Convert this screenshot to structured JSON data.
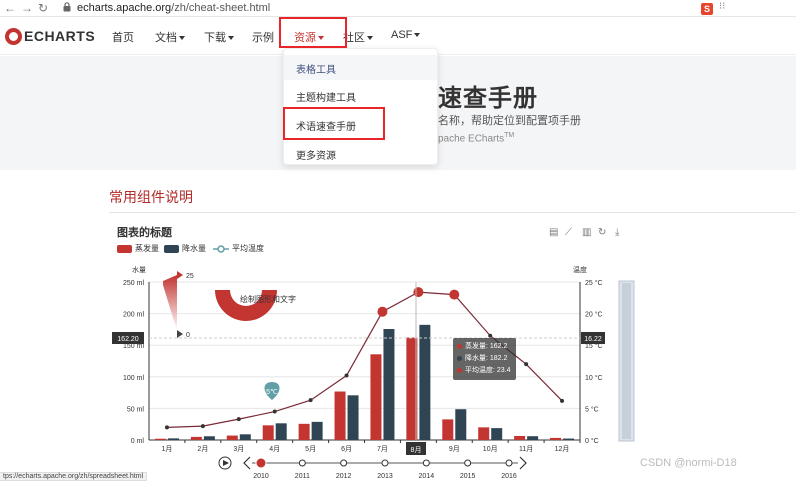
{
  "browser": {
    "url_host": "echarts.apache.org",
    "url_path": "/zh/cheat-sheet.html",
    "ext_label": "S"
  },
  "navbar": {
    "logo_text": "ECHARTS",
    "items": [
      {
        "label": "首页"
      },
      {
        "label": "文档"
      },
      {
        "label": "下载"
      },
      {
        "label": "示例"
      },
      {
        "label": "资源"
      },
      {
        "label": "社区"
      },
      {
        "label": "ASF"
      }
    ]
  },
  "dropdown": {
    "items": [
      {
        "label": "表格工具"
      },
      {
        "label": "主题构建工具"
      },
      {
        "label": "术语速查手册"
      },
      {
        "label": "更多资源"
      }
    ]
  },
  "hero": {
    "title": "速查手册",
    "subtitle": "名称，帮助定位到配置项手册",
    "sub2": "pache ECharts",
    "sub2_sup": "TM"
  },
  "section": {
    "title": "常用组件说明"
  },
  "chart_data": {
    "type": "bar",
    "title": "图表的标题",
    "categories": [
      "1月",
      "2月",
      "3月",
      "4月",
      "5月",
      "6月",
      "7月",
      "8月",
      "9月",
      "10月",
      "11月",
      "12月"
    ],
    "series": [
      {
        "name": "蒸发量",
        "type": "bar",
        "color": "#c23531",
        "values": [
          2.0,
          4.9,
          7.0,
          23.2,
          25.6,
          76.7,
          135.6,
          162.2,
          32.6,
          20.0,
          6.4,
          3.3
        ]
      },
      {
        "name": "降水量",
        "type": "bar",
        "color": "#2f4554",
        "values": [
          2.6,
          5.9,
          9.0,
          26.4,
          28.7,
          70.7,
          175.6,
          182.2,
          48.7,
          18.8,
          6.0,
          2.3
        ]
      },
      {
        "name": "平均温度",
        "type": "line",
        "color": "#61a0a8",
        "values": [
          2.0,
          2.2,
          3.3,
          4.5,
          6.3,
          10.2,
          20.3,
          23.4,
          23.0,
          16.5,
          12.0,
          6.2
        ]
      }
    ],
    "ylabel_left": "水量",
    "ylabel_right": "温度",
    "y_left_ticks": [
      "0 ml",
      "50 ml",
      "100 ml",
      "150 ml",
      "200 ml",
      "250 ml"
    ],
    "y_right_ticks": [
      "0 °C",
      "5 °C",
      "10 °C",
      "15 °C",
      "20 °C",
      "25 °C"
    ],
    "ylim_left": [
      0,
      250
    ],
    "ylim_right": [
      0,
      25
    ],
    "markline_left": "162.20",
    "markline_right": "16.22",
    "visualmap": {
      "max": "25",
      "min": "0"
    },
    "graphic_text": "绘制图形和文字",
    "mark_point": "5℃",
    "axis_pointer_label": "8月",
    "tooltip": [
      {
        "label": "蒸发量: 162.2",
        "color": "#c23531"
      },
      {
        "label": "降水量: 182.2",
        "color": "#2f4554"
      },
      {
        "label": "平均温度: 23.4",
        "color": "#c23531"
      }
    ],
    "timeline": [
      "2010",
      "2011",
      "2012",
      "2013",
      "2014",
      "2015",
      "2016"
    ]
  },
  "status": {
    "text": "tps://echarts.apache.org/zh/spreadsheet.html"
  },
  "watermark": "CSDN @normi-D18"
}
